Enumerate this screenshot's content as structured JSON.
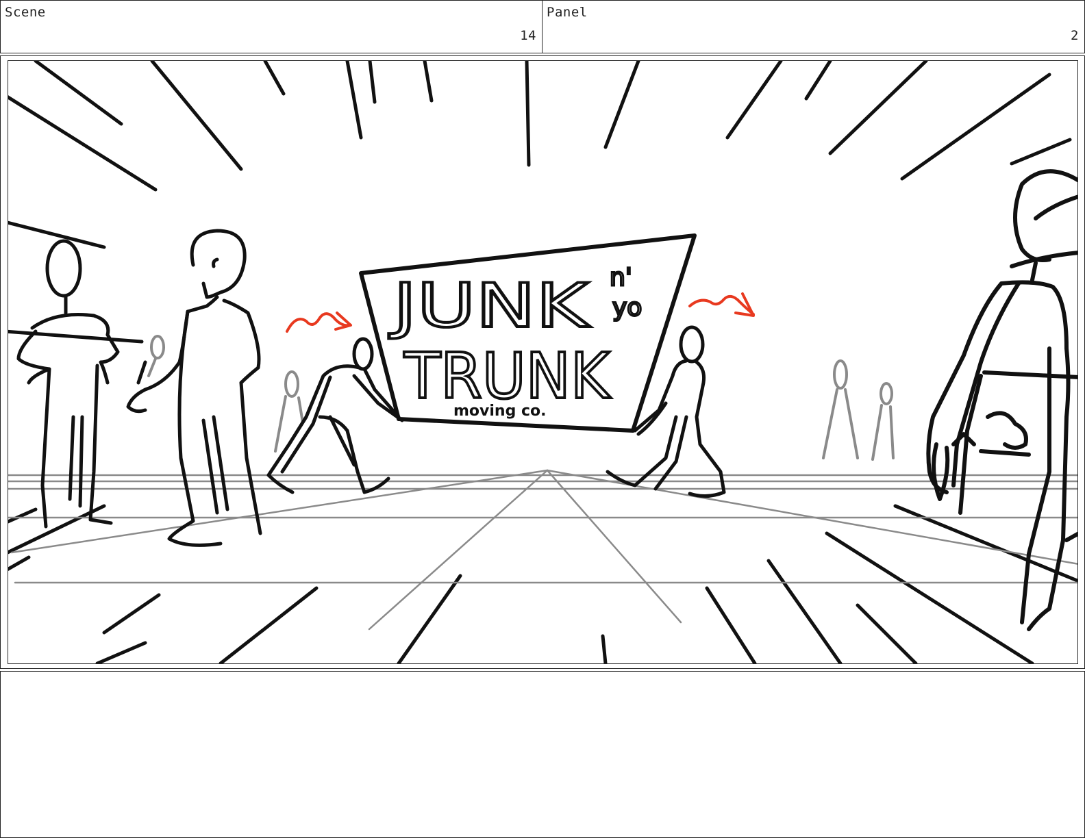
{
  "header": {
    "scene_label": "Scene",
    "scene_number": "14",
    "panel_label": "Panel",
    "panel_number": "2"
  },
  "sign": {
    "line1": "JUNK",
    "line1_suffix_top": "n'",
    "line1_suffix_bottom": "yo",
    "line2": "TRUNK",
    "line3": "moving co."
  },
  "colors": {
    "ink": "#111111",
    "guide_lines": "#8a8a8a",
    "motion_arrows": "#e8391f",
    "paper": "#ffffff"
  },
  "notes": {
    "text": ""
  }
}
